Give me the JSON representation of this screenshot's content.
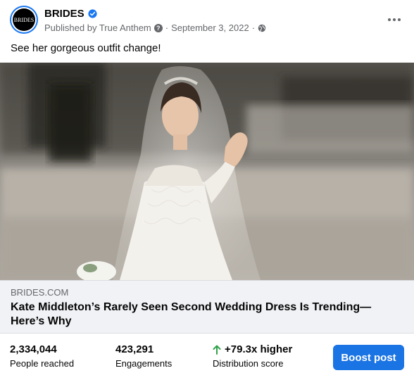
{
  "header": {
    "page_name": "BRIDES",
    "avatar_text": "BRIDES",
    "published_by": "Published by True Anthem",
    "separator": "·",
    "date": "September 3, 2022",
    "accent_color": "#1877f2"
  },
  "post": {
    "caption": "See her gorgeous outfit change!"
  },
  "link_preview": {
    "domain": "BRIDES.COM",
    "headline": "Kate Middleton’s Rarely Seen Second Wedding Dress Is Trending—Here’s Why"
  },
  "stats": {
    "people_reached": {
      "value": "2,334,044",
      "label": "People reached"
    },
    "engagements": {
      "value": "423,291",
      "label": "Engagements"
    },
    "distribution": {
      "value": "+79.3x higher",
      "label": "Distribution score",
      "arrow_color": "#31a24c"
    }
  },
  "actions": {
    "boost_label": "Boost post",
    "button_color": "#1b74e4"
  },
  "icons": [
    "verified-badge-icon",
    "help-icon",
    "globe-icon",
    "more-icon",
    "arrow-up-icon"
  ]
}
